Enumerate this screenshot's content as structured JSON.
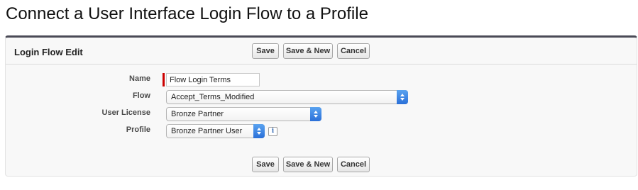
{
  "page": {
    "title": "Connect a User Interface Login Flow to a Profile"
  },
  "panel": {
    "title": "Login Flow Edit",
    "buttons": {
      "save": "Save",
      "save_new": "Save & New",
      "cancel": "Cancel"
    }
  },
  "form": {
    "name": {
      "label": "Name",
      "value": "Flow Login Terms"
    },
    "flow": {
      "label": "Flow",
      "value": "Accept_Terms_Modified"
    },
    "user_license": {
      "label": "User License",
      "value": "Bronze Partner"
    },
    "profile": {
      "label": "Profile",
      "value": "Bronze Partner User",
      "info_icon": "i"
    }
  },
  "colors": {
    "required": "#cc0000",
    "select_accent": "#2a6fd8",
    "panel_top_border": "#4a4a56"
  },
  "icons": {
    "select_arrow": "up-down-chevron-icon",
    "info": "info-icon"
  }
}
